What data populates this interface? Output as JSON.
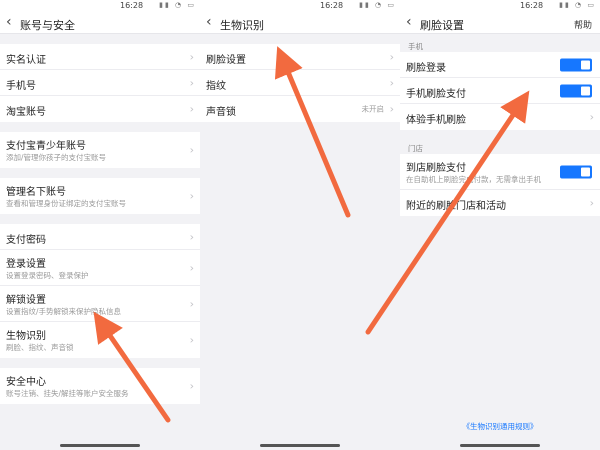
{
  "status_bar": {
    "time": "16:28"
  },
  "screen1": {
    "title": "账号与安全",
    "group1": [
      {
        "label": "实名认证"
      },
      {
        "label": "手机号"
      },
      {
        "label": "淘宝账号"
      }
    ],
    "group2": [
      {
        "label": "支付宝青少年账号",
        "sub": "添加/管理你孩子的支付宝账号"
      }
    ],
    "group3": [
      {
        "label": "管理名下账号",
        "sub": "查看和管理身份证绑定的支付宝账号"
      }
    ],
    "group4": [
      {
        "label": "支付密码"
      },
      {
        "label": "登录设置",
        "sub": "设置登录密码、登录保护"
      },
      {
        "label": "解锁设置",
        "sub": "设置指纹/手势解锁来保护隐私信息"
      },
      {
        "label": "生物识别",
        "sub": "刷脸、指纹、声音锁"
      }
    ],
    "group5": [
      {
        "label": "安全中心",
        "sub": "账号注销、挂失/解挂等账户安全服务"
      }
    ]
  },
  "screen2": {
    "title": "生物识别",
    "items": [
      {
        "label": "刷脸设置"
      },
      {
        "label": "指纹"
      },
      {
        "label": "声音锁",
        "value": "未开启"
      }
    ]
  },
  "screen3": {
    "title": "刷脸设置",
    "help": "帮助",
    "section1": "手机",
    "items1": [
      {
        "label": "刷脸登录",
        "toggle": true
      },
      {
        "label": "手机刷脸支付",
        "toggle": true
      },
      {
        "label": "体验手机刷脸"
      }
    ],
    "section2": "门店",
    "items2": [
      {
        "label": "到店刷脸支付",
        "sub": "在自助机上刷脸完成付款，无需拿出手机",
        "toggle": true
      },
      {
        "label": "附近的刷脸门店和活动"
      }
    ],
    "footer_link": "《生物识别通用规则》"
  },
  "colors": {
    "accent": "#1677ff",
    "arrow": "#f26a3f"
  },
  "icons": {
    "back": "chevron-left-icon",
    "chevron": "chevron-right-icon"
  }
}
